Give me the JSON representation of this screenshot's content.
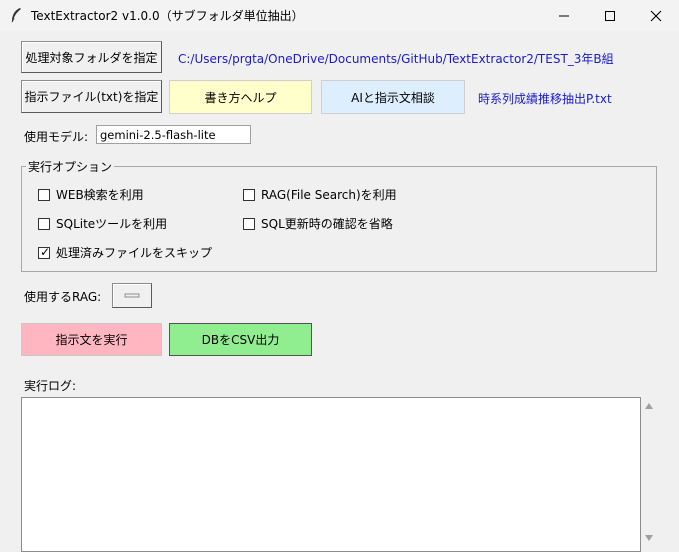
{
  "window": {
    "title": "TextExtractor2 v1.0.0（サブフォルダ単位抽出）",
    "controls": {
      "minimize": "—",
      "maximize": "☐",
      "close": "✕"
    }
  },
  "folder": {
    "button_label": "処理対象フォルダを指定",
    "path": "C:/Users/prgta/OneDrive/Documents/GitHub/TextExtractor2/TEST_3年B組"
  },
  "instruction": {
    "button_label": "指示ファイル(txt)を指定",
    "help_label": "書き方ヘルプ",
    "consult_label": "AIと指示文相談",
    "file_name": "時系列成績推移抽出P.txt"
  },
  "model": {
    "label": "使用モデル:",
    "value": "gemini-2.5-flash-lite"
  },
  "options": {
    "legend": "実行オプション",
    "web_search": {
      "label": "WEB検索を利用",
      "checked": false
    },
    "rag_file_search": {
      "label": "RAG(File Search)を利用",
      "checked": false
    },
    "sqlite_tool": {
      "label": "SQLiteツールを利用",
      "checked": false
    },
    "skip_sql_confirm": {
      "label": "SQL更新時の確認を省略",
      "checked": false
    },
    "skip_processed": {
      "label": "処理済みファイルをスキップ",
      "checked": true
    }
  },
  "rag": {
    "label": "使用するRAG:",
    "value": ""
  },
  "actions": {
    "run_label": "指示文を実行",
    "csv_label": "DBをCSV出力"
  },
  "log": {
    "label": "実行ログ:",
    "content": ""
  },
  "colors": {
    "help_bg": "#ffffcc",
    "consult_bg": "#ddeeff",
    "run_bg": "#ffb6c1",
    "csv_bg": "#90ee90",
    "link": "#1a1ad0"
  }
}
